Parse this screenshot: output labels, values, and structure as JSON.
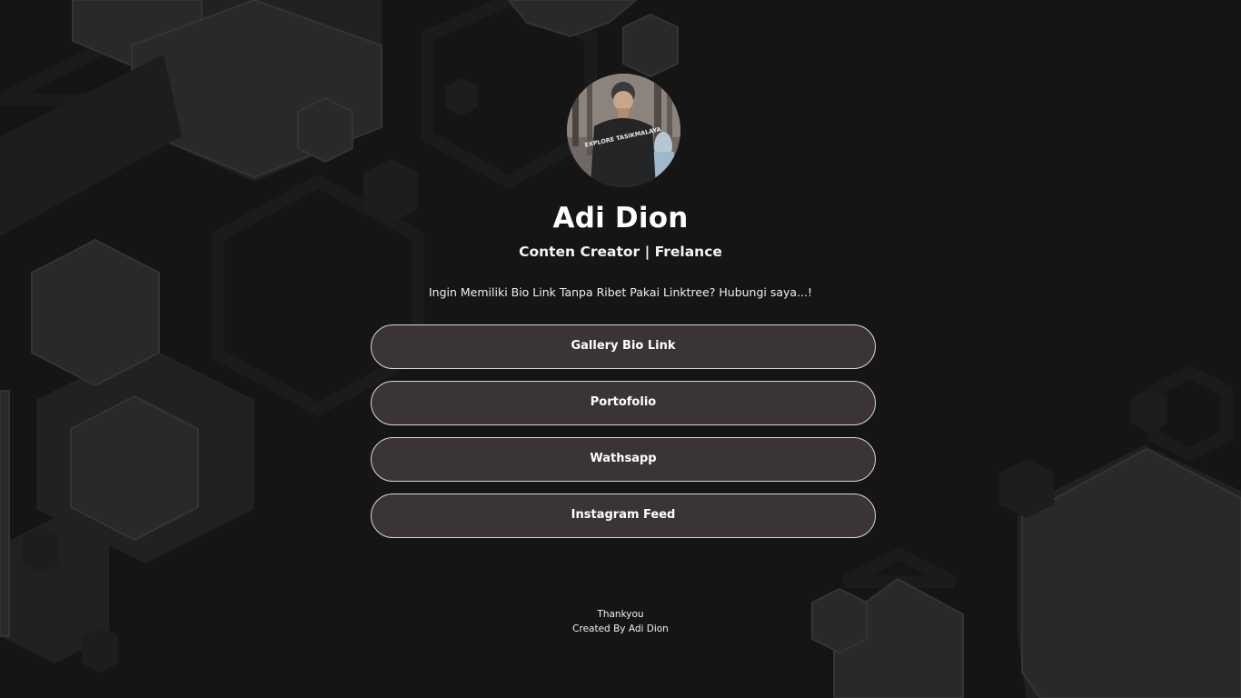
{
  "profile": {
    "name": "Adi Dion",
    "tagline": "Conten Creator | Frelance",
    "description": "Ingin Memiliki Bio Link Tanpa Ribet Pakai Linktree? Hubungi saya...!",
    "avatar_shirt_text": "EXPLORE TASIKMALAYA"
  },
  "links": [
    {
      "label": "Gallery Bio Link"
    },
    {
      "label": "Portofolio"
    },
    {
      "label": "Wathsapp"
    },
    {
      "label": "Instagram Feed"
    }
  ],
  "footer": {
    "line1": "Thankyou",
    "line2": "Created By Adi Dion"
  },
  "colors": {
    "background": "#161516",
    "hexagon_fill": "#262526",
    "button_fill": "#3a3439",
    "button_border": "#d9d6d9"
  }
}
